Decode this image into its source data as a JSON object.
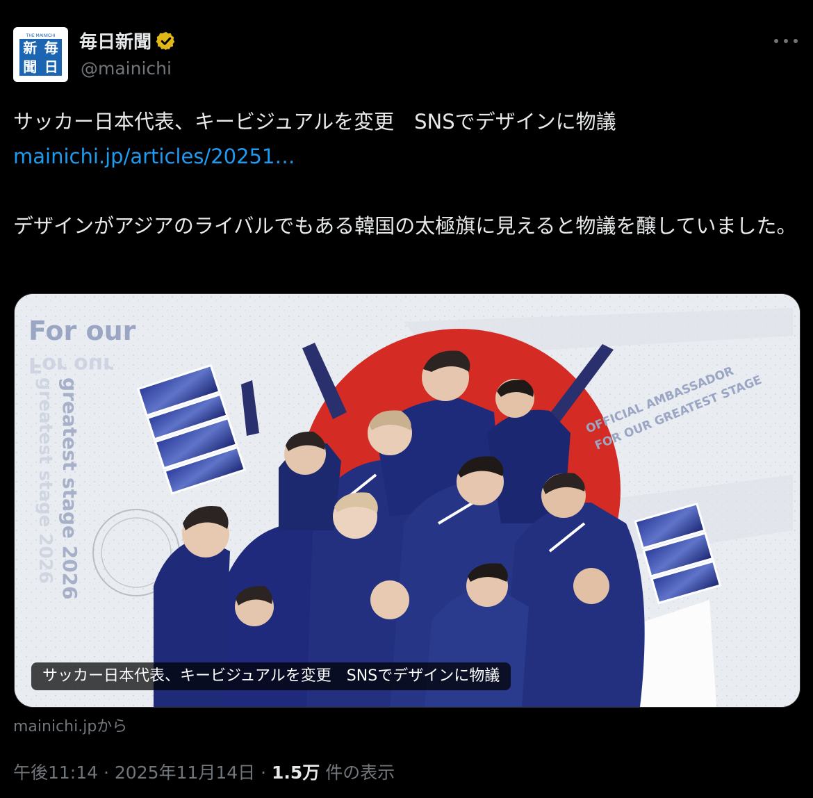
{
  "author": {
    "name": "毎日新聞",
    "handle": "@mainichi",
    "avatar_chars": [
      "新",
      "毎",
      "聞",
      "日"
    ],
    "avatar_small_text": "THE MAINICHI",
    "verified": true,
    "brand_color": "#1b65b3"
  },
  "post": {
    "headline": "サッカー日本代表、キービジュアルを変更　SNSでデザインに物議",
    "link_text": "mainichi.jp/articles/20251…",
    "paragraph": "デザインがアジアのライバルでもある韓国の太極旗に見えると物議を醸していました。"
  },
  "card": {
    "caption": "サッカー日本代表、キービジュアルを変更　SNSでデザインに物議",
    "image_text_top": "For our",
    "image_text_vertical": "greatest stage 2026",
    "image_text_ambassador_1": "OFFICIAL AMBASSADOR",
    "image_text_ambassador_2": "FOR OUR GREATEST STAGE",
    "source": "mainichi.jpから"
  },
  "meta": {
    "time": "午後11:14",
    "separator": "·",
    "date": "2025年11月14日",
    "views_count": "1.5万",
    "views_label": "件の表示"
  },
  "colors": {
    "background": "#000000",
    "text_primary": "#e7e9ea",
    "text_secondary": "#71767b",
    "link": "#1d9bf0",
    "verified_badge": "#e2b719",
    "flag_red": "#d42c24",
    "jersey_blue": "#20287a"
  }
}
